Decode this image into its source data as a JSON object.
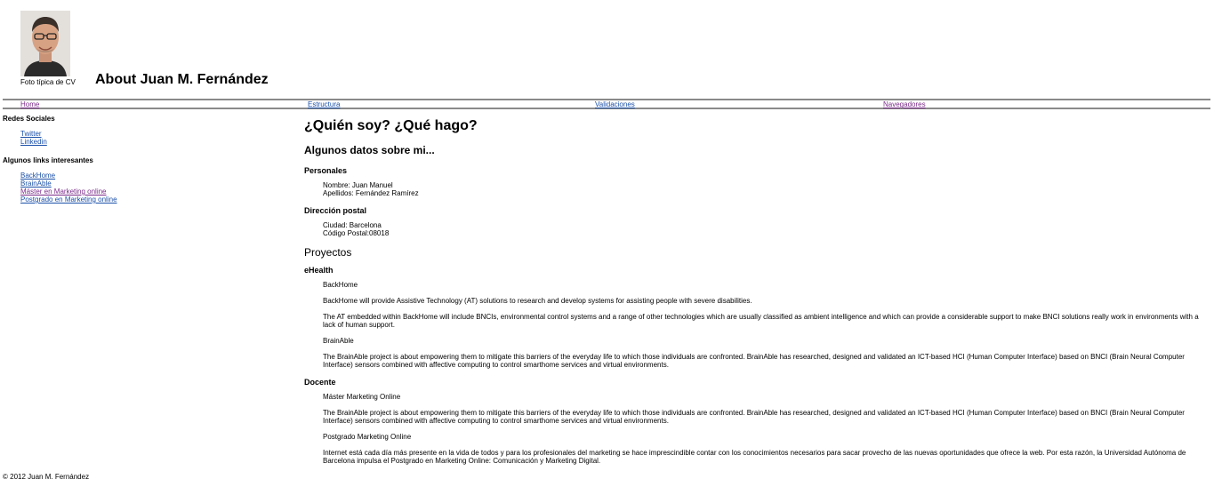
{
  "header": {
    "photo_caption": "Foto típica de CV",
    "title": "About Juan M. Fernández"
  },
  "nav": [
    "Home",
    "Estructura",
    "Validaciones",
    "Navegadores"
  ],
  "sidebar": {
    "sections": [
      {
        "heading": "Redes Sociales",
        "links": [
          "Twitter",
          "Linkedin"
        ]
      },
      {
        "heading": "Algunos links interesantes",
        "links": [
          "BackHome",
          "BrainAble",
          "Máster en Marketing online",
          "Postgrado en Marketing online"
        ]
      }
    ]
  },
  "main": {
    "title": "¿Quién soy? ¿Qué hago?",
    "datos": {
      "heading": "Algunos datos sobre mi...",
      "personales_heading": "Personales",
      "nombre": "Nombre: Juan Manuel",
      "apellidos": "Apellidos: Fernández Ramírez",
      "direccion_heading": "Dirección postal",
      "ciudad": "Ciudad: Barcelona",
      "cp": "Código Postal:08018"
    },
    "proyectos": {
      "heading": "Proyectos",
      "ehealth_heading": "eHealth",
      "backhome_title": "BackHome",
      "backhome_p1": "BackHome will provide Assistive Technology (AT) solutions to research and develop systems for assisting people with severe disabilities.",
      "backhome_p2": "The AT embedded within BackHome will include BNCIs, environmental control systems and a range of other technologies which are usually classified as ambient intelligence and which can provide a considerable support to make BNCI solutions really work in environments with a lack of human support.",
      "brainable_title": "BrainAble",
      "brainable_p1": "The BrainAble project is about empowering them to mitigate this barriers of the everyday life to which those individuals are confronted. BrainAble has researched, designed and validated an ICT-based HCI (Human Computer Interface) based on BNCI (Brain Neural Computer Interface) sensors combined with affective computing to control smarthome services and virtual environments.",
      "docente_heading": "Docente",
      "master_title": "Máster Marketing Online",
      "master_p1": "The BrainAble project is about empowering them to mitigate this barriers of the everyday life to which those individuals are confronted. BrainAble has researched, designed and validated an ICT-based HCI (Human Computer Interface) based on BNCI (Brain Neural Computer Interface) sensors combined with affective computing to control smarthome services and virtual environments.",
      "postgrado_title": "Postgrado Marketing Online",
      "postgrado_p1": "Internet está cada día más presente en la vida de todos y para los profesionales del marketing se hace imprescindible contar con los conocimientos necesarios para sacar provecho de las nuevas oportunidades que ofrece la web. Por esta razón, la Universidad Autónoma de Barcelona impulsa el Postgrado en Marketing Online: Comunicación y Marketing Digital."
    }
  },
  "footer": "© 2012 Juan M. Fernández"
}
